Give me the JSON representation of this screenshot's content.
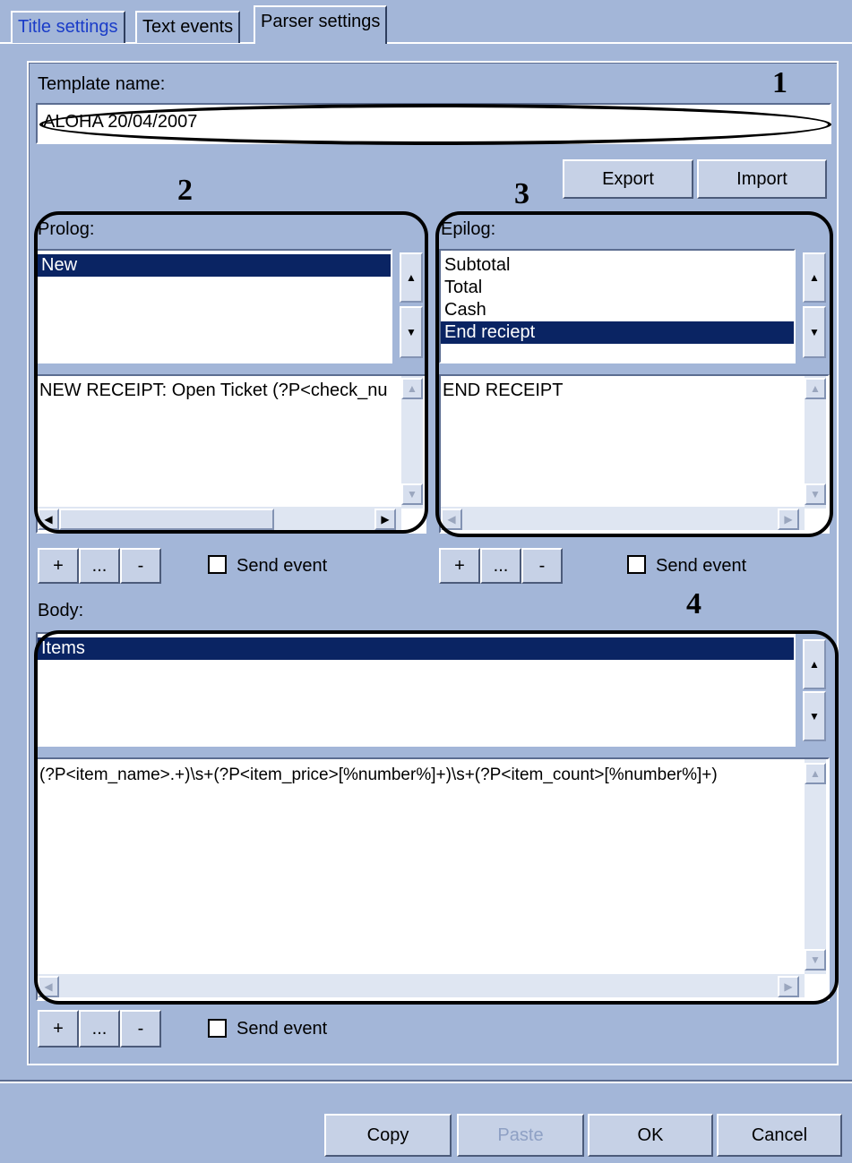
{
  "tabs": [
    "Title settings",
    "Text events",
    "Parser settings"
  ],
  "template": {
    "label": "Template name:",
    "value": "ALOHA 20/04/2007"
  },
  "buttons": {
    "export": "Export",
    "import": "Import",
    "copy": "Copy",
    "paste": "Paste",
    "ok": "OK",
    "cancel": "Cancel",
    "add": "+",
    "edit": "...",
    "remove": "-"
  },
  "prolog": {
    "label": "Prolog:",
    "items": [
      "New"
    ],
    "pattern": "NEW RECEIPT: Open Ticket (?P<check_nu",
    "send_event": "Send event"
  },
  "epilog": {
    "label": "Epilog:",
    "items": [
      "Subtotal",
      "Total",
      "Cash",
      "End reciept"
    ],
    "pattern": "END RECEIPT",
    "send_event": "Send event"
  },
  "body": {
    "label": "Body:",
    "items": [
      "Items"
    ],
    "pattern": "(?P<item_name>.+)\\s+(?P<item_price>[%number%]+)\\s+(?P<item_count>[%number%]+)",
    "send_event": "Send event"
  },
  "callouts": [
    "1",
    "2",
    "3",
    "4"
  ]
}
